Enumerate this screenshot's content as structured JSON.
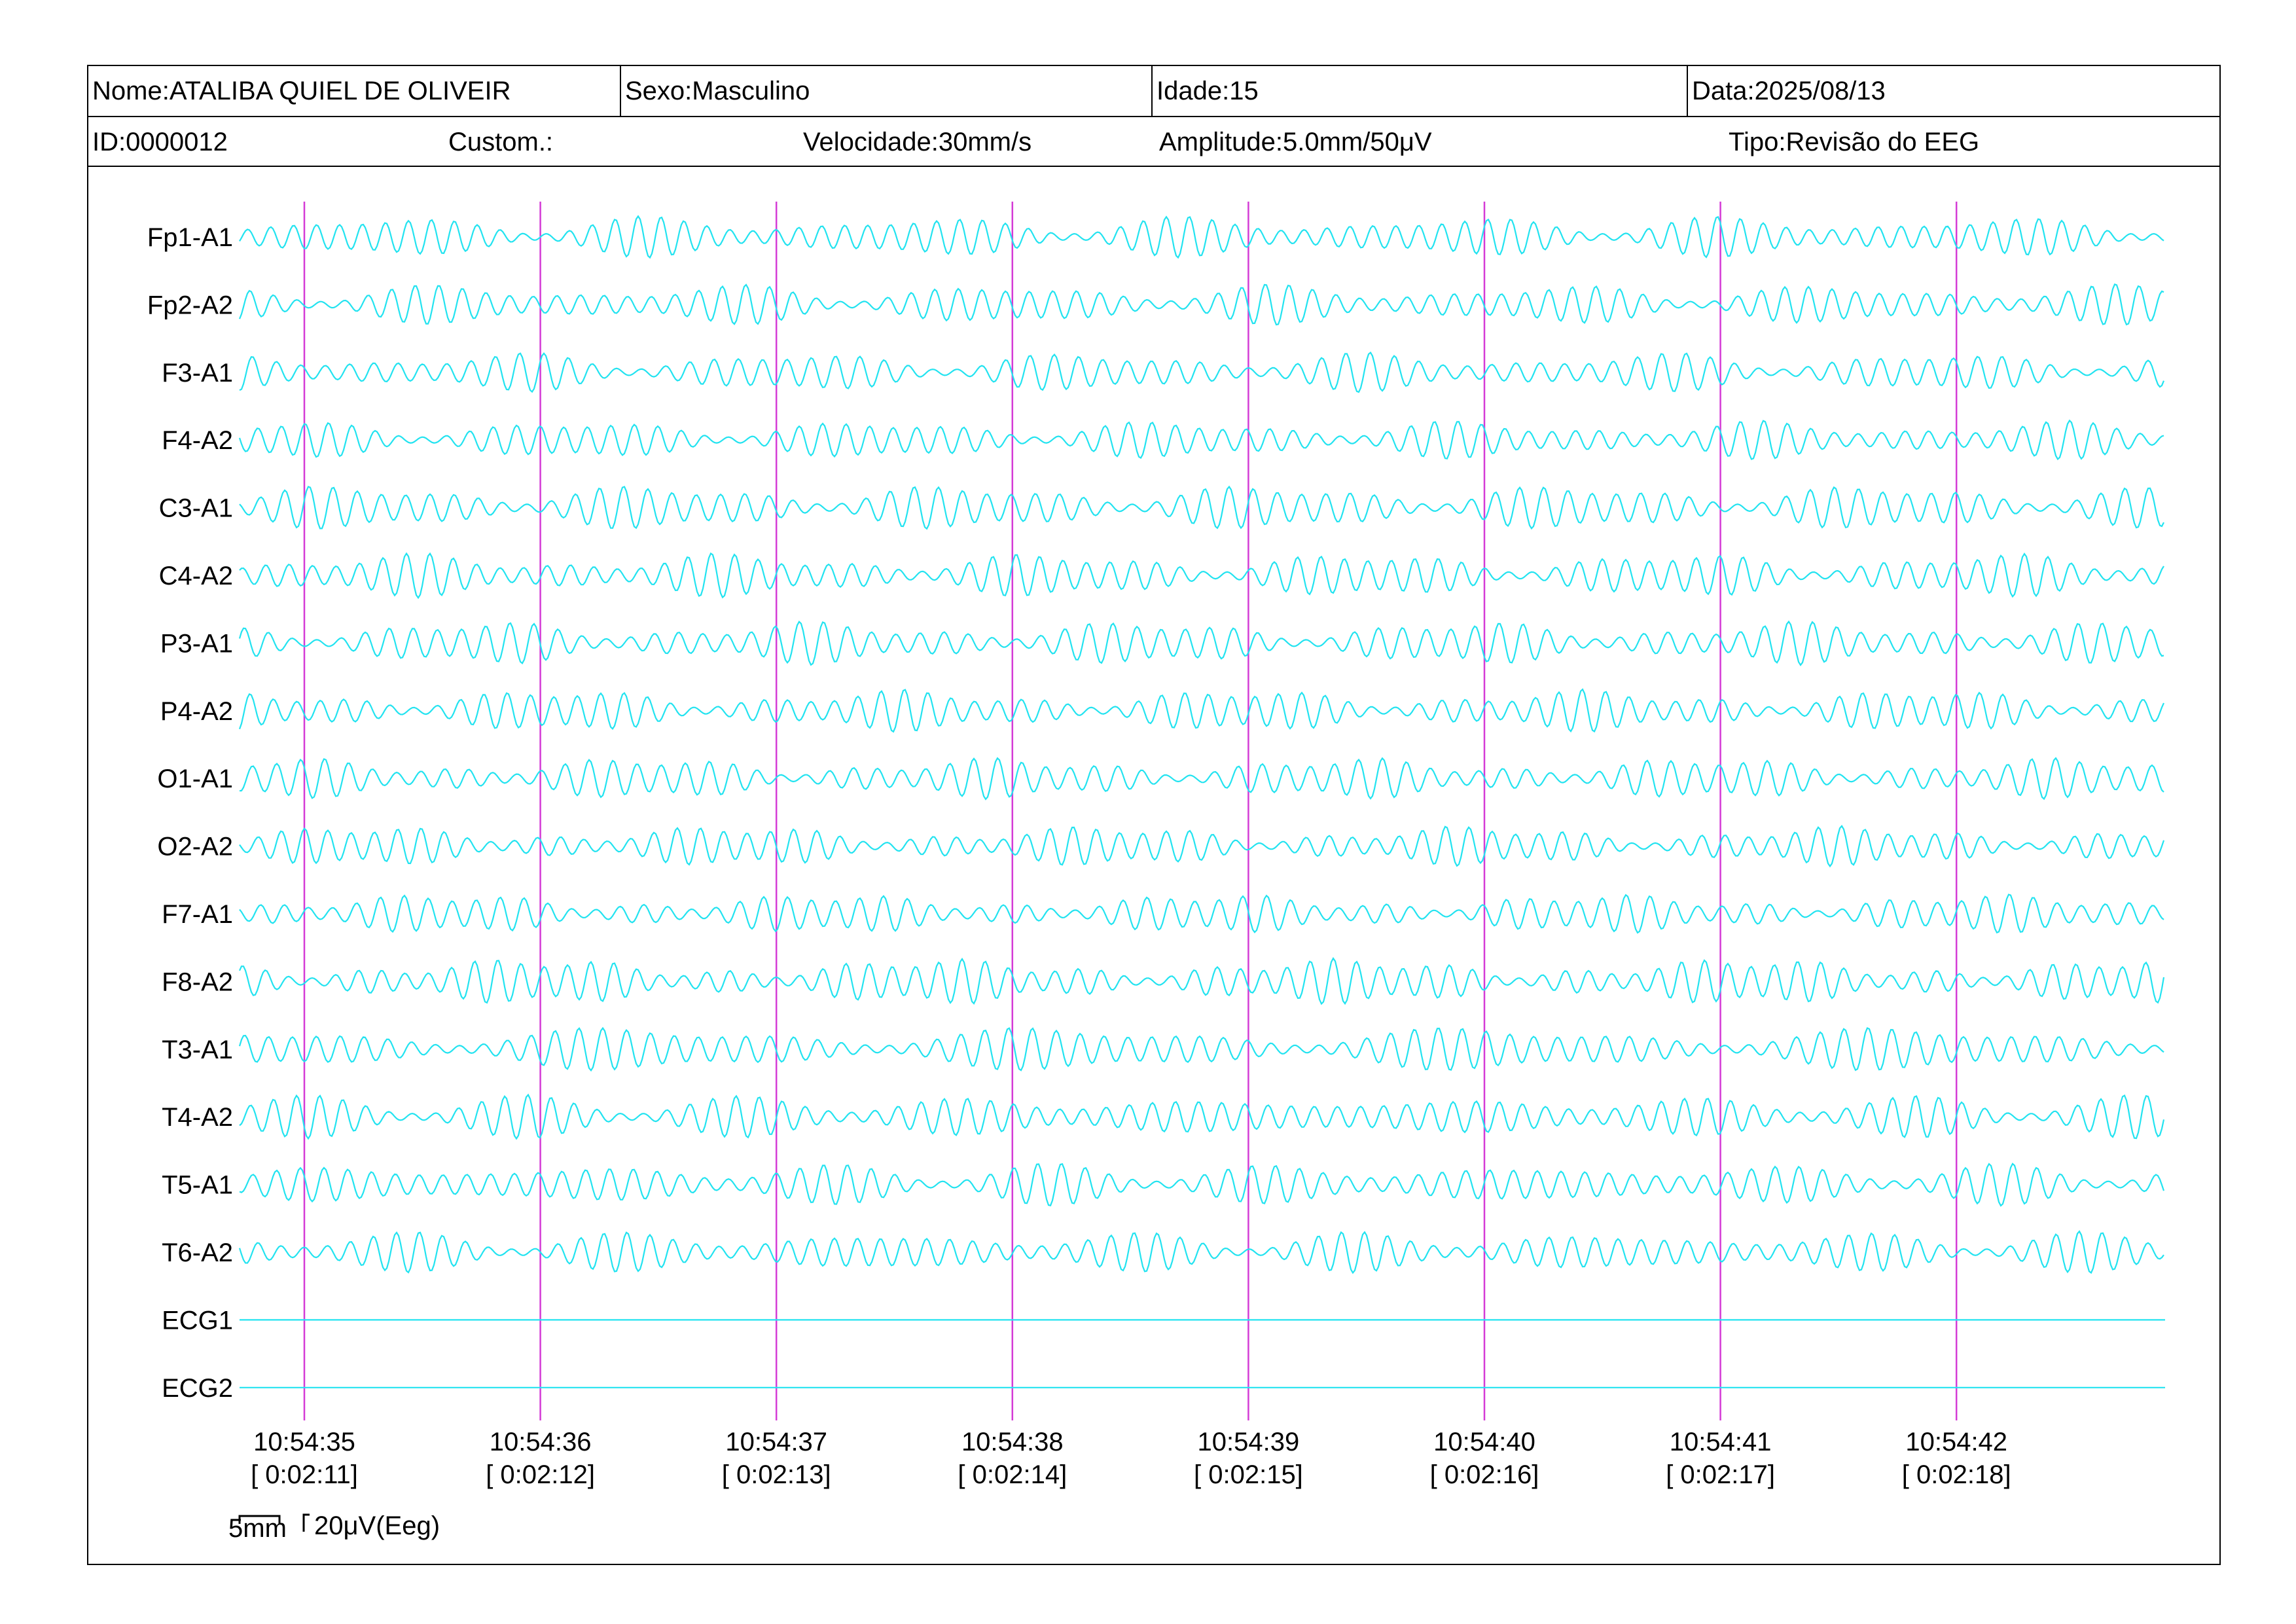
{
  "header": {
    "name": "Nome:ATALIBA QUIEL DE OLIVEIR",
    "sex": "Sexo:Masculino",
    "age": "Idade:15",
    "date": "Data:2025/08/13",
    "id": "ID:0000012",
    "custom": "Custom.:",
    "speed": "Velocidade:30mm/s",
    "amplitude": "Amplitude:5.0mm/50μV",
    "type": "Tipo:Revisão do EEG"
  },
  "scale": {
    "time_label": "5mm",
    "amp_label": "20μV(Eeg)"
  },
  "colors": {
    "trace": "#22e3f0",
    "marker": "#d43bd6",
    "text": "#000000"
  },
  "chart_data": {
    "type": "line",
    "title": "",
    "channels": [
      "Fp1-A1",
      "Fp2-A2",
      "F3-A1",
      "F4-A2",
      "C3-A1",
      "C4-A2",
      "P3-A1",
      "P4-A2",
      "O1-A1",
      "O2-A2",
      "F7-A1",
      "F8-A2",
      "T3-A1",
      "T4-A2",
      "T5-A1",
      "T6-A2",
      "ECG1",
      "ECG2"
    ],
    "flat_channels": [
      "ECG1",
      "ECG2"
    ],
    "time_ticks": [
      "10:54:35",
      "10:54:36",
      "10:54:37",
      "10:54:38",
      "10:54:39",
      "10:54:40",
      "10:54:41",
      "10:54:42"
    ],
    "elapsed_ticks": [
      "[ 0:02:11]",
      "[ 0:02:12]",
      "[ 0:02:13]",
      "[ 0:02:14]",
      "[ 0:02:15]",
      "[ 0:02:16]",
      "[ 0:02:17]",
      "[ 0:02:18]"
    ],
    "x_range_seconds": [
      -0.28,
      7.9
    ],
    "dominant_frequency_hz": 10
  }
}
